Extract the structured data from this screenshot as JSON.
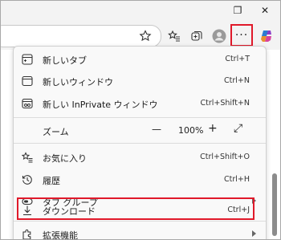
{
  "window": {
    "restore_glyph": "❐",
    "close_glyph": "✕"
  },
  "toolbar": {
    "more_glyph": "···",
    "icons": [
      "star-add-icon",
      "favorites-icon",
      "collections-icon",
      "profile-icon",
      "more-icon",
      "copilot-icon"
    ]
  },
  "menu": {
    "items": [
      {
        "label": "新しいタブ",
        "shortcut": "Ctrl+T"
      },
      {
        "label": "新しいウィンドウ",
        "shortcut": "Ctrl+N"
      },
      {
        "label": "新しい InPrivate ウィンドウ",
        "shortcut": "Ctrl+Shift+N"
      }
    ],
    "zoom": {
      "label": "ズーム",
      "minus": "—",
      "value": "100%",
      "plus": "+",
      "fullscreen": "⤢"
    },
    "items2": [
      {
        "label": "お気に入り",
        "shortcut": "Ctrl+Shift+O"
      },
      {
        "label": "履歴",
        "shortcut": "Ctrl+H"
      },
      {
        "label": "タブ グループ",
        "shortcut": ""
      },
      {
        "label": "ダウンロード",
        "shortcut": "Ctrl+J"
      },
      {
        "label": "拡張機能",
        "shortcut": ""
      }
    ]
  },
  "colors": {
    "highlight": "#e0192a",
    "menu_bg": "#f9f9f9"
  }
}
